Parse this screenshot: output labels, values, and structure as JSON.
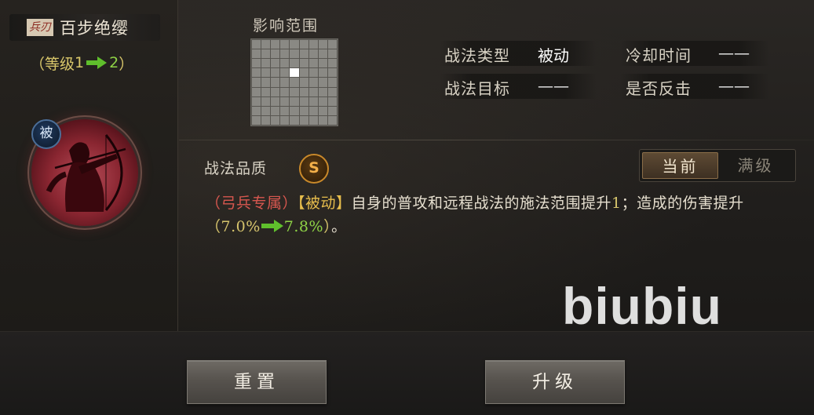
{
  "skill": {
    "weapon_tag": "兵刃",
    "name": "百步绝缨",
    "level_prefix": "（等级",
    "level_from": "1",
    "level_to": "2",
    "level_suffix": "）",
    "badge": "被"
  },
  "range": {
    "title": "影响范围",
    "grid_size": 9,
    "highlight_cell": [
      3,
      4
    ]
  },
  "info": {
    "type_label": "战法类型",
    "type_value": "被动",
    "cooldown_label": "冷却时间",
    "cooldown_value": "——",
    "target_label": "战法目标",
    "target_value": "——",
    "counter_label": "是否反击",
    "counter_value": "——"
  },
  "quality": {
    "label": "战法品质",
    "grade": "S"
  },
  "toggle": {
    "current": "当前",
    "max": "满级"
  },
  "description": {
    "tag1": "（弓兵专属）",
    "tag2": "【被动】",
    "text1": "自身的普攻和远程战法的施法范围提升",
    "num": "1",
    "text2": "；造成的伤害提升",
    "open": "（",
    "from": "7.0%",
    "to": "7.8%",
    "close": "）",
    "end": "。"
  },
  "watermark": "biubiu",
  "buttons": {
    "reset": "重置",
    "upgrade": "升级"
  },
  "colors": {
    "level_arrow": "#5fbf2c",
    "quality_ring": "#c9892a",
    "desc_red": "#d7574f",
    "desc_gold": "#e7bd4c"
  }
}
